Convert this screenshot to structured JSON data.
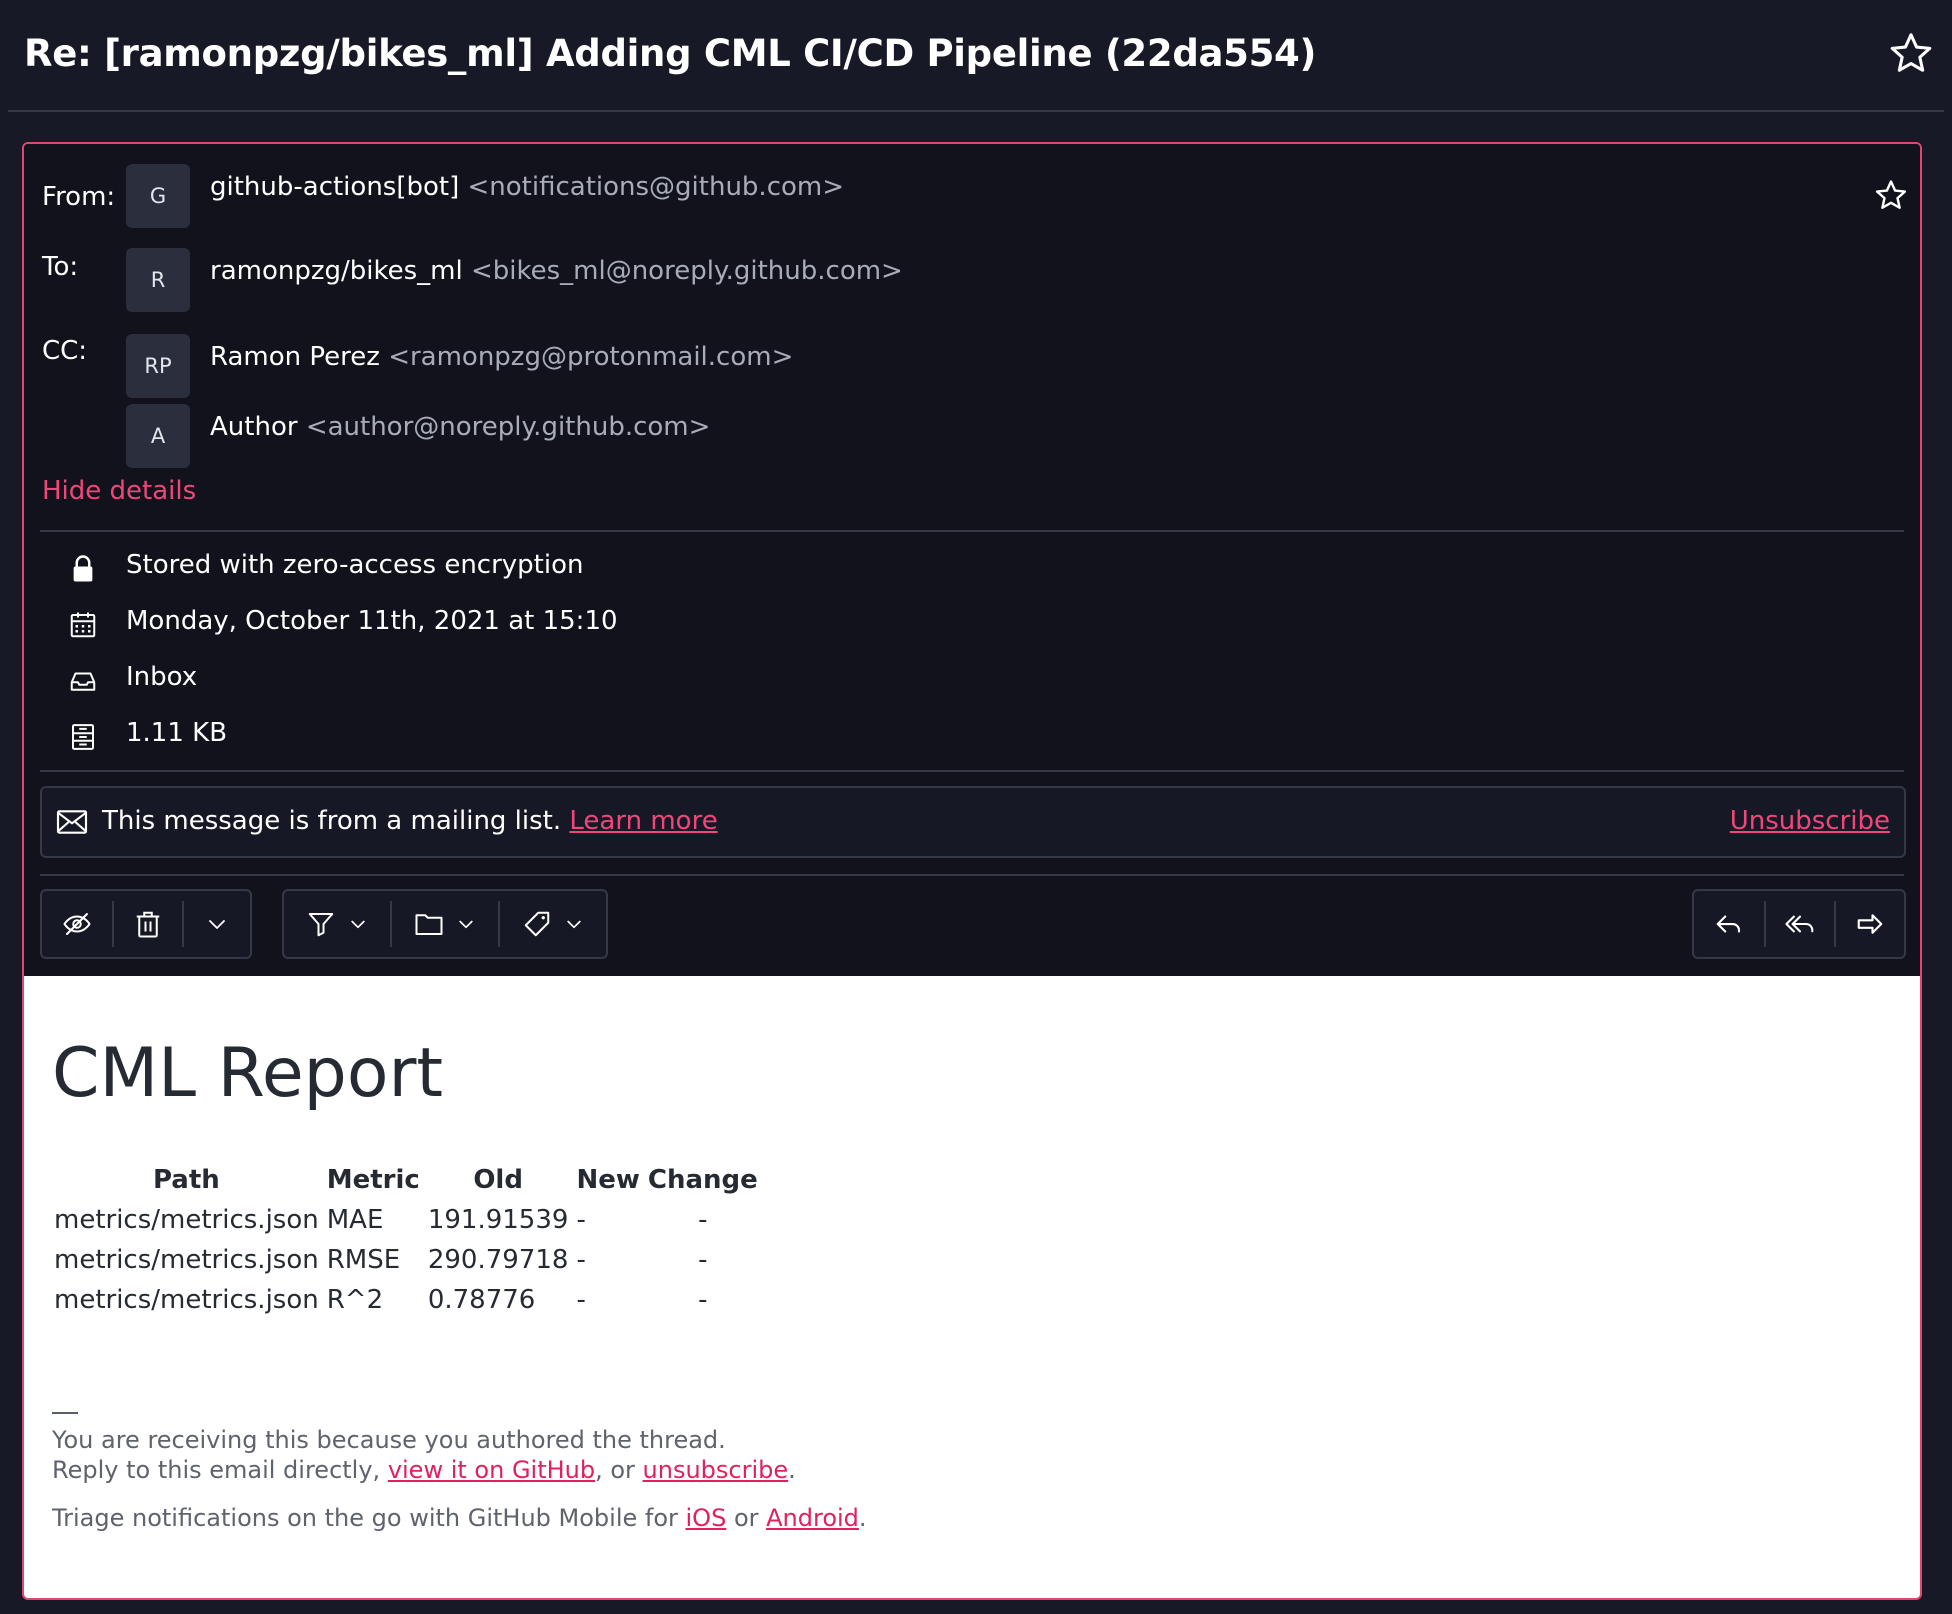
{
  "subject": "Re: [ramonpzg/bikes_ml] Adding CML CI/CD Pipeline (22da554)",
  "header": {
    "from_label": "From:",
    "to_label": "To:",
    "cc_label": "CC:",
    "from": {
      "initials": "G",
      "name": "github-actions[bot]",
      "address": "<notifications@github.com>"
    },
    "to": {
      "initials": "R",
      "name": "ramonpzg/bikes_ml",
      "address": "<bikes_ml@noreply.github.com>"
    },
    "cc": [
      {
        "initials": "RP",
        "name": "Ramon Perez",
        "address": "<ramonpzg@protonmail.com>"
      },
      {
        "initials": "A",
        "name": "Author",
        "address": "<author@noreply.github.com>"
      }
    ],
    "hide_details": "Hide details"
  },
  "details": {
    "encryption": "Stored with zero-access encryption",
    "date": "Monday, October 11th, 2021 at 15:10",
    "folder": "Inbox",
    "size": "1.11 KB"
  },
  "mailing_list": {
    "message": "This message is from a mailing list.",
    "learn_more": "Learn more",
    "unsubscribe": "Unsubscribe"
  },
  "toolbar": {
    "icons": [
      "eye-slash-icon",
      "trash-icon",
      "chevron-down-icon",
      "filter-icon",
      "folder-icon",
      "tag-icon",
      "reply-icon",
      "reply-all-icon",
      "forward-icon"
    ]
  },
  "body": {
    "title": "CML Report",
    "table": {
      "headers": [
        "Path",
        "Metric",
        "Old",
        "New",
        "Change"
      ],
      "rows": [
        [
          "metrics/metrics.json",
          "MAE",
          "191.91539",
          "-",
          "-"
        ],
        [
          "metrics/metrics.json",
          "RMSE",
          "290.79718",
          "-",
          "-"
        ],
        [
          "metrics/metrics.json",
          "R^2",
          "0.78776",
          "-",
          "-"
        ]
      ]
    },
    "footer": {
      "line1": "You are receiving this because you authored the thread.",
      "line2_pre": "Reply to this email directly, ",
      "view_on_github": "view it on GitHub",
      "line2_mid": ", or ",
      "unsubscribe": "unsubscribe",
      "line2_end": ".",
      "line3_pre": "Triage notifications on the go with GitHub Mobile for ",
      "ios": "iOS",
      "line3_mid": " or ",
      "android": "Android",
      "line3_end": "."
    }
  },
  "colors": {
    "accent": "#f0467a",
    "background": "#171a26",
    "panel": "#11121c",
    "border_accent": "#e0476e"
  }
}
